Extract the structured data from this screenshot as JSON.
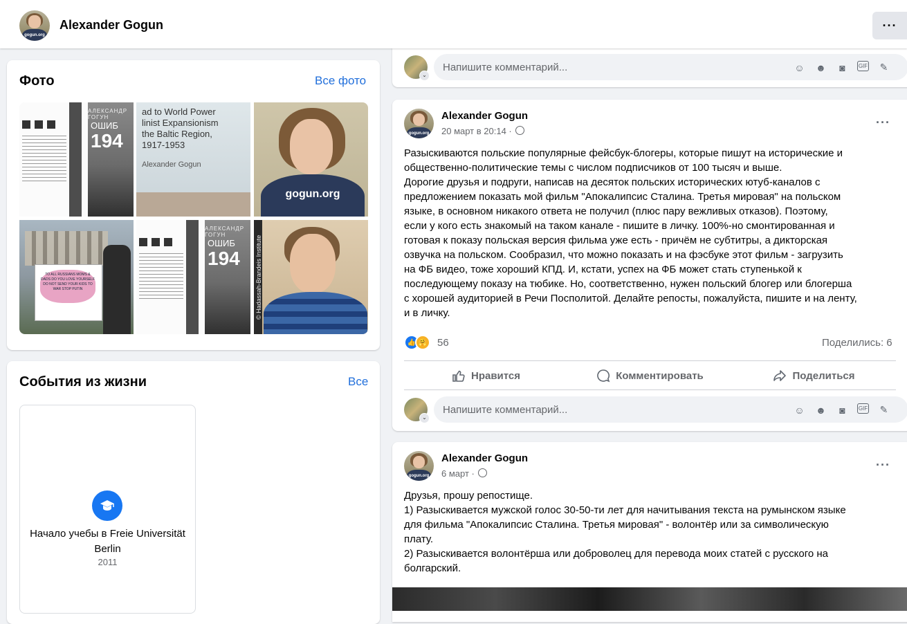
{
  "header": {
    "name": "Alexander Gogun",
    "more": "···"
  },
  "avatar_text": "gogun.org",
  "photos": {
    "title": "Фото",
    "link": "Все фото",
    "book_author": "АЛЕКСАНДР ГОГУН",
    "book_title": "ОШИБ",
    "book_year": "194",
    "slide_text": "ad to World Power\nlinist Expansionism\nthe Baltic Region,\n1917-1953",
    "slide_by": "Alexander Gogun",
    "portrait_shirt": "gogun.org",
    "demo_sign": "TO ALL RUSSIANS MOMS & DADS DO YOU LOVE YOURSELF DO NOT SEND YOUR KIDS TO WAR STOP PUTIN",
    "portrait2_band": "© Hadassah-Brandeis Institute"
  },
  "life_events": {
    "title": "События из жизни",
    "link": "Все",
    "event_title": "Начало учебы в Freie Universität Berlin",
    "event_year": "2011"
  },
  "comment": {
    "placeholder": "Напишите комментарий..."
  },
  "posts": [
    {
      "author": "Alexander Gogun",
      "date": "20 март в 20:14 ·",
      "more": "···",
      "text": "Разыскиваются польские популярные фейсбук-блогеры, которые пишут на исторические и\nобщественно-политические темы с числом подписчиков от 100 тысяч и выше.\nДорогие друзья и подруги, написав на десяток польских исторических ютуб-каналов с\nпредложением показать мой фильм \"Апокалипсис Сталина. Третья мировая\" на польском\nязыке, в основном никакого ответа не получил (плюс пару вежливых отказов). Поэтому,\nесли у кого есть знакомый на таком канале - пишите в личку. 100%-но смонтированная и\nготовая к показу польская версия фильма уже есть - причём не субтитры, а дикторская\nозвучка на польском. Сообразил, что можно показать и на фэсбуке этот фильм - загрузить\nна ФБ видео, тоже хороший КПД. И, кстати, успех на ФБ может стать ступенькой к\nпоследующему показу на тюбике. Но, соответственно, нужен польский блогер или блогерша\nс хорошей аудиторией в Речи Посполитой. Делайте репосты, пожалуйста, пишите и на ленту,\nи в личку.",
      "reactions_count": "56",
      "shares": "Поделились: 6",
      "like": "Нравится",
      "comment": "Комментировать",
      "share": "Поделиться"
    },
    {
      "author": "Alexander Gogun",
      "date": "6 март ·",
      "more": "···",
      "text": "Друзья, прошу репостище.\n1) Разыскивается мужской голос 30-50-ти лет для начитывания текста на румынском языке\nдля фильма \"Апокалипсис Сталина. Третья мировая\" - волонтёр или за символическую\nплату.\n2) Разыскивается волонтёрша или доброволец для перевода моих статей с русского на\nболгарский."
    }
  ],
  "colors": {
    "accent": "#216fdb",
    "brand": "#1877f2",
    "background": "#f0f2f5"
  }
}
